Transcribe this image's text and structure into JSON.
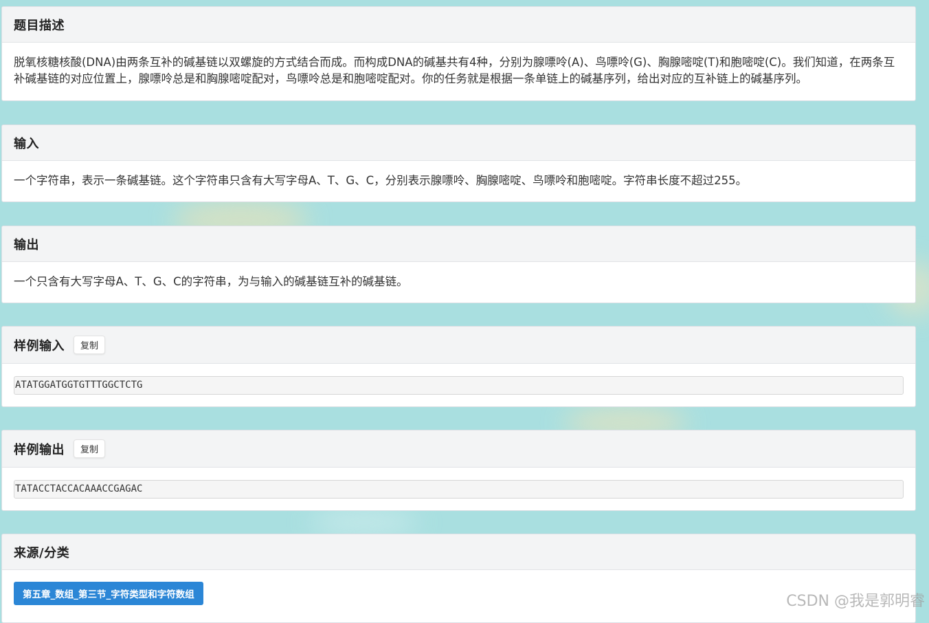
{
  "sections": {
    "description": {
      "title": "题目描述",
      "text": "脱氧核糖核酸(DNA)由两条互补的碱基链以双螺旋的方式结合而成。而构成DNA的碱基共有4种，分别为腺嘌呤(A)、鸟嘌呤(G)、胸腺嘧啶(T)和胞嘧啶(C)。我们知道，在两条互补碱基链的对应位置上，腺嘌呤总是和胸腺嘧啶配对，鸟嘌呤总是和胞嘧啶配对。你的任务就是根据一条单链上的碱基序列，给出对应的互补链上的碱基序列。"
    },
    "input": {
      "title": "输入",
      "text": "一个字符串，表示一条碱基链。这个字符串只含有大写字母A、T、G、C，分别表示腺嘌呤、胸腺嘧啶、鸟嘌呤和胞嘧啶。字符串长度不超过255。"
    },
    "output": {
      "title": "输出",
      "text": "一个只含有大写字母A、T、G、C的字符串，为与输入的碱基链互补的碱基链。"
    },
    "sample_input": {
      "title": "样例输入",
      "copy_label": "复制",
      "value": "ATATGGATGGTGTTTGGCTCTG"
    },
    "sample_output": {
      "title": "样例输出",
      "copy_label": "复制",
      "value": "TATACCTACCACAAACCGAGAC"
    },
    "source": {
      "title": "来源/分类",
      "tag": "第五章_数组_第三节_字符类型和字符数组"
    }
  },
  "watermark": "CSDN @我是郭明睿",
  "colors": {
    "background": "#a9dfe0",
    "panel_header": "#f3f4f5",
    "tag_blue": "#2b86d6"
  }
}
